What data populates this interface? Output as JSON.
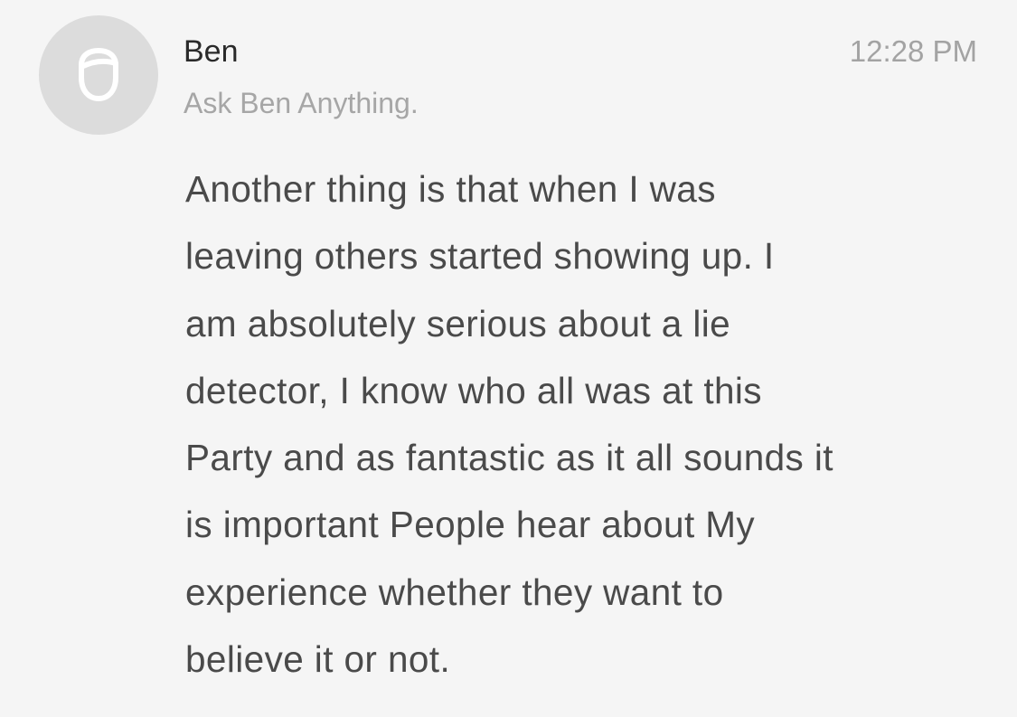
{
  "message": {
    "sender": "Ben",
    "subtitle": "Ask Ben Anything.",
    "time": "12:28 PM",
    "avatar_icon": "person-head-icon",
    "body_lines": [
      "Another thing is that when I was",
      "leaving others started showing up. I",
      "am absolutely serious about a lie",
      "detector, I know who all was at this",
      "Party and as fantastic as it all sounds it",
      "is important People hear about My",
      "experience whether they want to",
      "believe it or not."
    ]
  },
  "colors": {
    "background": "#f5f5f5",
    "avatar_bg": "#dcdcdc",
    "avatar_icon": "#ffffff",
    "sender_text": "#2a2a2a",
    "muted_text": "#a6a6a6",
    "body_text": "#4a4a4a"
  }
}
